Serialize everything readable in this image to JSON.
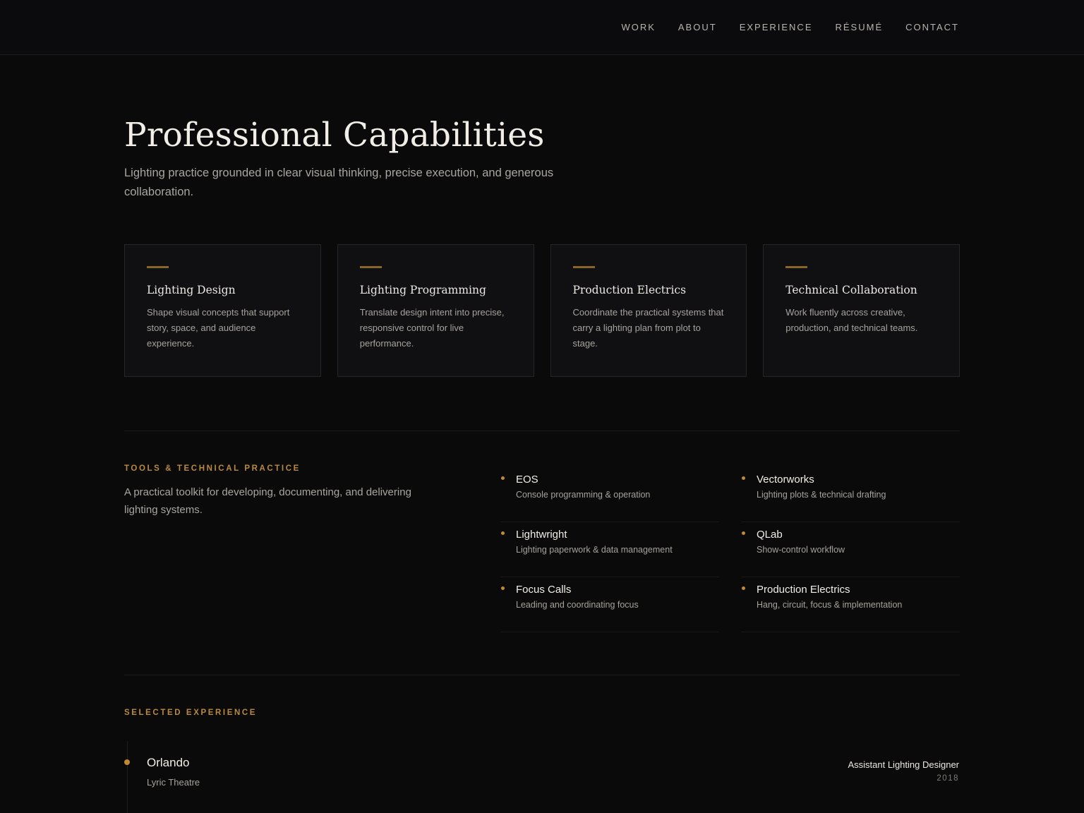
{
  "nav": {
    "items": [
      {
        "label": "WORK"
      },
      {
        "label": "ABOUT"
      },
      {
        "label": "EXPERIENCE"
      },
      {
        "label": "RÉSUMÉ"
      },
      {
        "label": "CONTACT"
      }
    ]
  },
  "intro": {
    "title": "Professional Capabilities",
    "subtitle": "Lighting practice grounded in clear visual thinking, precise execution, and generous collaboration."
  },
  "capabilities": [
    {
      "title": "Lighting Design",
      "body": "Shape visual concepts that support story, space, and audience experience."
    },
    {
      "title": "Lighting Programming",
      "body": "Translate design intent into precise, responsive control for live performance."
    },
    {
      "title": "Production Electrics",
      "body": "Coordinate the practical systems that carry a lighting plan from plot to stage."
    },
    {
      "title": "Technical Collaboration",
      "body": "Work fluently across creative, production, and technical teams."
    }
  ],
  "tools": {
    "heading": "TOOLS & TECHNICAL PRACTICE",
    "description": "A practical toolkit for developing, documenting, and delivering lighting systems.",
    "items": [
      {
        "name": "EOS",
        "desc": "Console programming & operation"
      },
      {
        "name": "Vectorworks",
        "desc": "Lighting plots & technical drafting"
      },
      {
        "name": "Lightwright",
        "desc": "Lighting paperwork & data management"
      },
      {
        "name": "QLab",
        "desc": "Show-control workflow"
      },
      {
        "name": "Focus Calls",
        "desc": "Leading and coordinating focus"
      },
      {
        "name": "Production Electrics",
        "desc": "Hang, circuit, focus & implementation"
      }
    ]
  },
  "experience": {
    "heading": "SELECTED EXPERIENCE",
    "entries": [
      {
        "title": "Orlando",
        "venue": "Lyric Theatre",
        "role": "Assistant Lighting Designer",
        "year": "2018"
      }
    ]
  },
  "colors": {
    "background": "#0a0a0b",
    "accent": "#c08a35",
    "card": "#101013"
  }
}
